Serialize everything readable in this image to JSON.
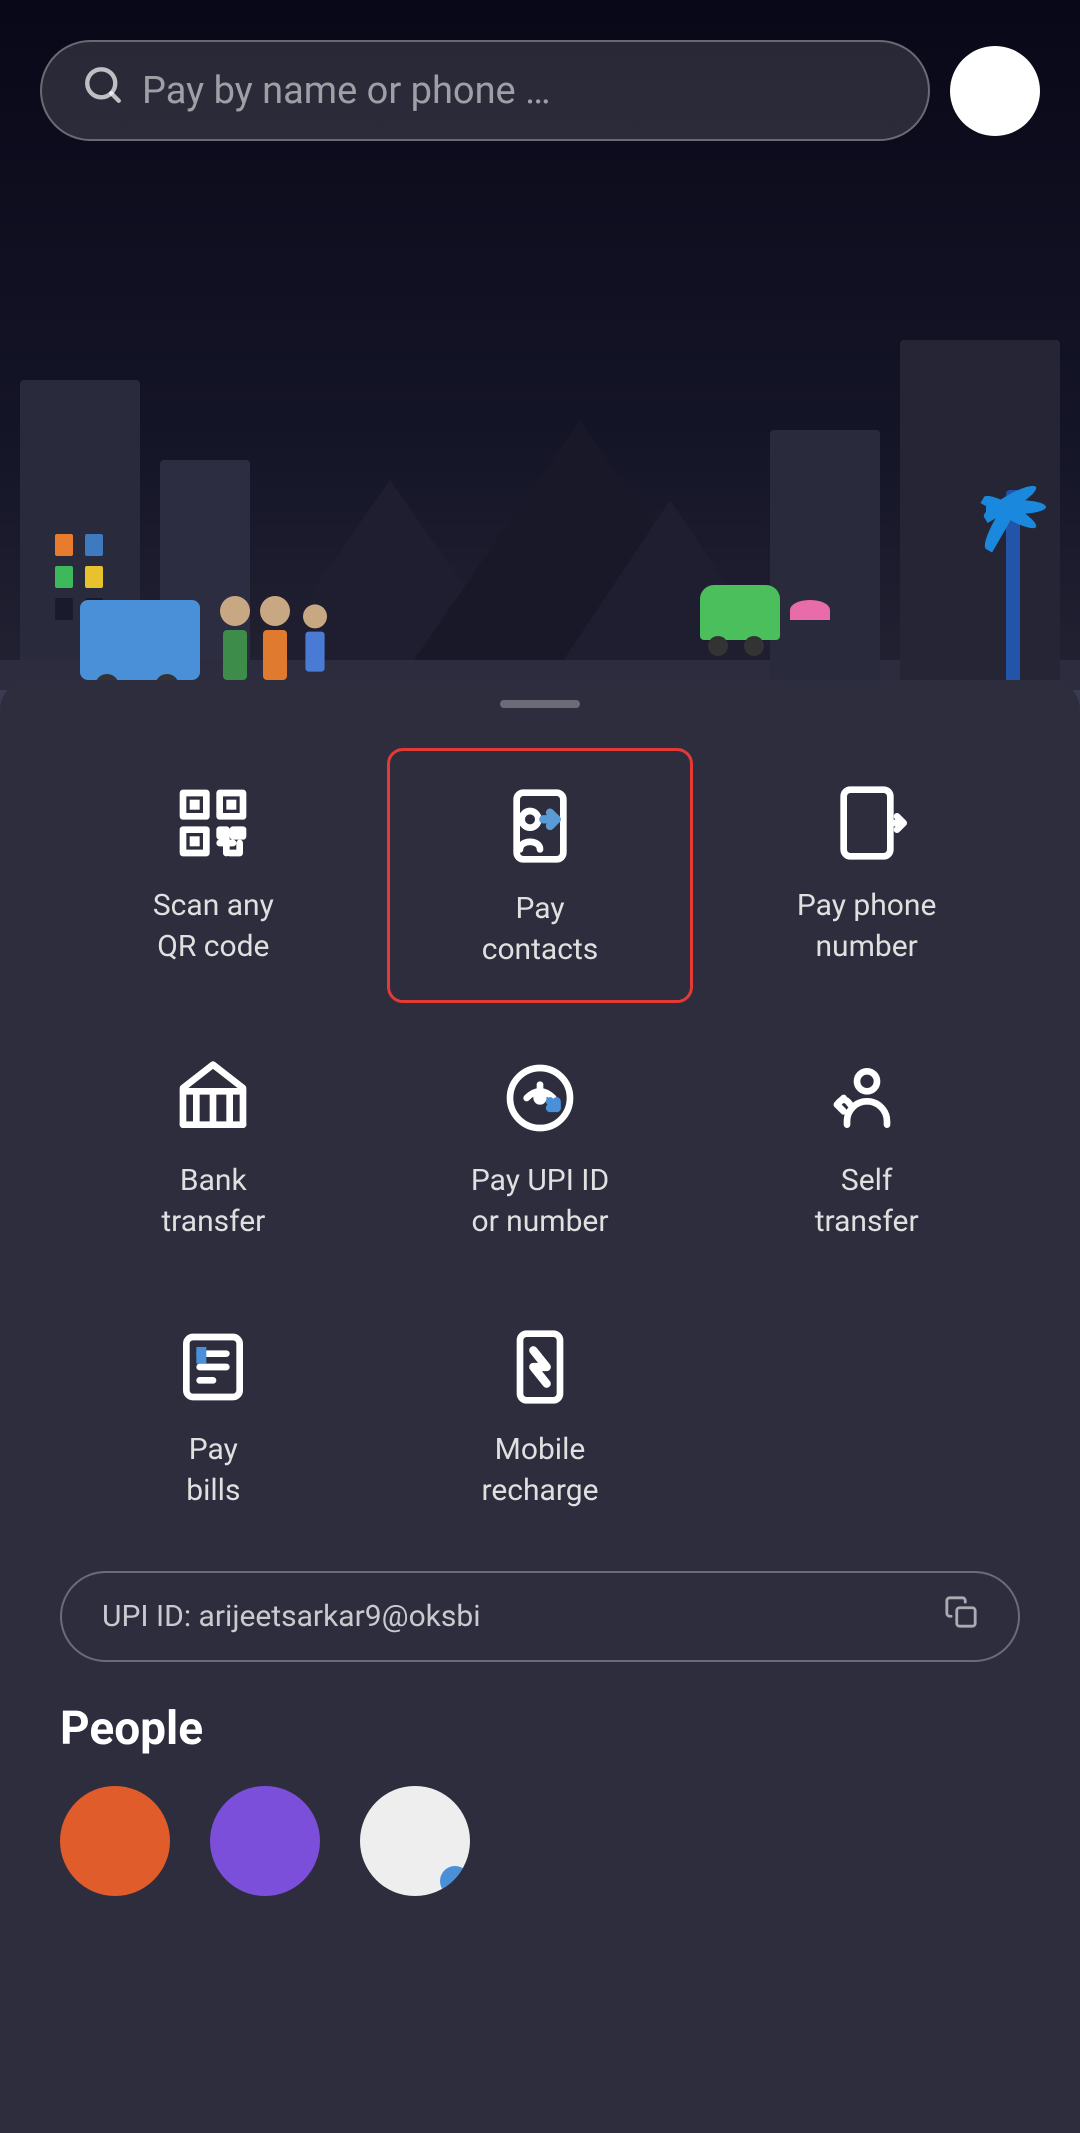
{
  "search": {
    "placeholder": "Pay by name or phone …"
  },
  "actions": {
    "row1": [
      {
        "id": "scan-qr",
        "label": "Scan any\nQR code",
        "highlighted": false,
        "icon": "qr-code-icon"
      },
      {
        "id": "pay-contacts",
        "label": "Pay\ncontacts",
        "highlighted": true,
        "icon": "pay-contacts-icon"
      },
      {
        "id": "pay-phone",
        "label": "Pay phone\nnumber",
        "highlighted": false,
        "icon": "pay-phone-icon"
      }
    ],
    "row2": [
      {
        "id": "bank-transfer",
        "label": "Bank\ntransfer",
        "highlighted": false,
        "icon": "bank-icon"
      },
      {
        "id": "pay-upi",
        "label": "Pay UPI ID\nor number",
        "highlighted": false,
        "icon": "upi-icon"
      },
      {
        "id": "self-transfer",
        "label": "Self\ntransfer",
        "highlighted": false,
        "icon": "self-transfer-icon"
      }
    ],
    "row3": [
      {
        "id": "pay-bills",
        "label": "Pay\nbills",
        "highlighted": false,
        "icon": "bills-icon"
      },
      {
        "id": "mobile-recharge",
        "label": "Mobile\nrecharge",
        "highlighted": false,
        "icon": "mobile-recharge-icon"
      }
    ]
  },
  "upi": {
    "label": "UPI ID: arijeetsarkar9@oksbi"
  },
  "people": {
    "section_title": "People"
  }
}
